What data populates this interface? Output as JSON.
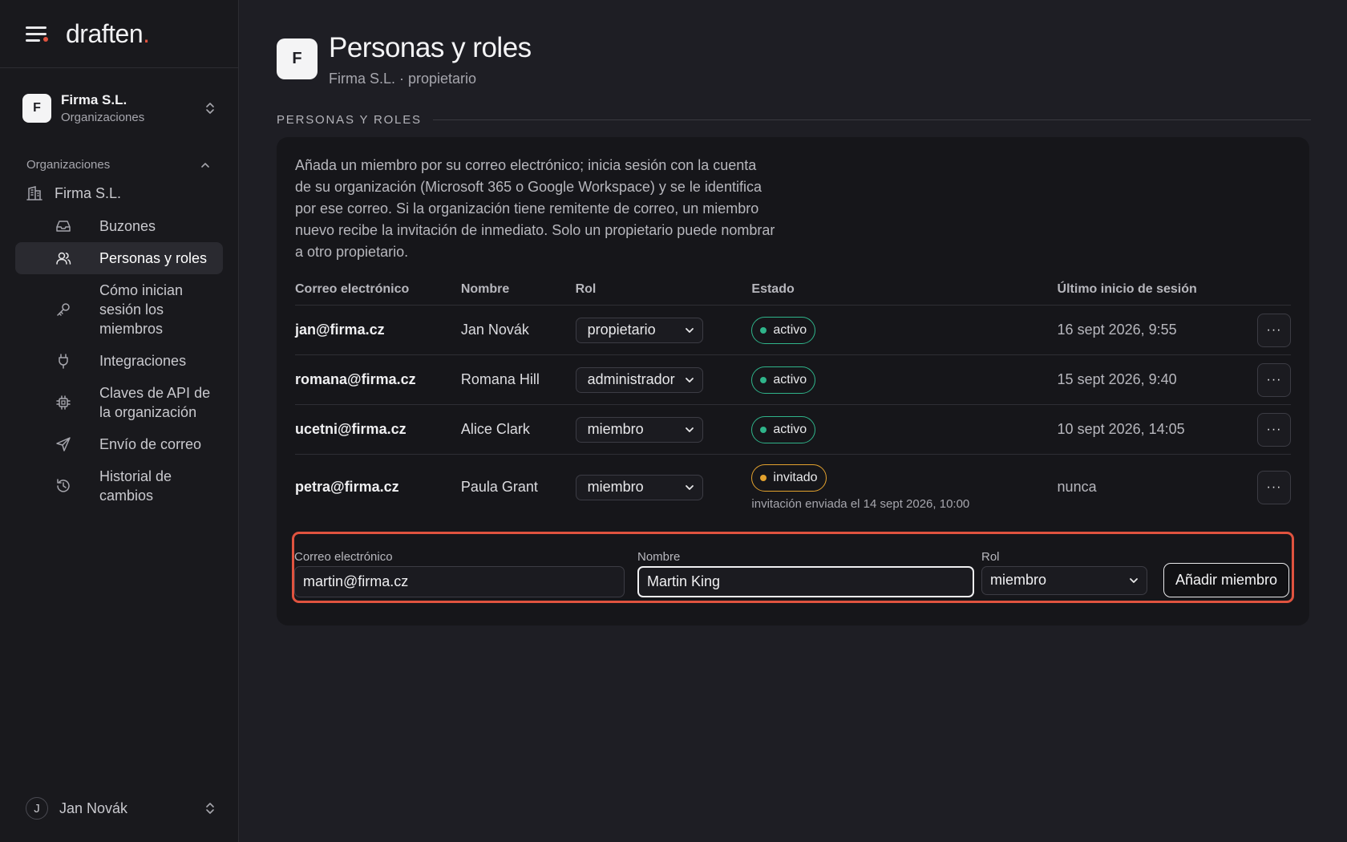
{
  "app": {
    "logo_text": "draften",
    "logo_dot": ".",
    "accent": "#e0533f"
  },
  "sidebar": {
    "org": {
      "initial": "F",
      "name": "Firma S.L.",
      "subtitle": "Organizaciones"
    },
    "section_title": "Organizaciones",
    "org_link": "Firma S.L.",
    "items": [
      {
        "label": "Buzones",
        "icon": "inbox-icon"
      },
      {
        "label": "Personas y roles",
        "icon": "users-icon",
        "active": true
      },
      {
        "label": "Cómo inician sesión los miembros",
        "icon": "key-icon"
      },
      {
        "label": "Integraciones",
        "icon": "plug-icon"
      },
      {
        "label": "Claves de API de la organización",
        "icon": "chip-icon"
      },
      {
        "label": "Envío de correo",
        "icon": "send-icon"
      },
      {
        "label": "Historial de cambios",
        "icon": "history-icon"
      }
    ],
    "user": {
      "initial": "J",
      "name": "Jan Novák"
    }
  },
  "page": {
    "avatar": "F",
    "title": "Personas y roles",
    "subtitle": "Firma S.L. · propietario",
    "section_label": "PERSONAS Y ROLES",
    "intro": "Añada un miembro por su correo electrónico; inicia sesión con la cuenta de su organización (Microsoft 365 o Google Workspace) y se le identifica por ese correo. Si la organización tiene remitente de correo, un miembro nuevo recibe la invitación de inmediato. Solo un propietario puede nombrar a otro propietario."
  },
  "table": {
    "headers": {
      "email": "Correo electrónico",
      "name": "Nombre",
      "role": "Rol",
      "state": "Estado",
      "last": "Último inicio de sesión"
    },
    "rows": [
      {
        "email": "jan@firma.cz",
        "name": "Jan Novák",
        "role": "propietario",
        "state": "activo",
        "last": "16 sept 2026, 9:55"
      },
      {
        "email": "romana@firma.cz",
        "name": "Romana Hill",
        "role": "administrador",
        "state": "activo",
        "last": "15 sept 2026, 9:40"
      },
      {
        "email": "ucetni@firma.cz",
        "name": "Alice Clark",
        "role": "miembro",
        "state": "activo",
        "last": "10 sept 2026, 14:05"
      },
      {
        "email": "petra@firma.cz",
        "name": "Paula Grant",
        "role": "miembro",
        "state": "invitado",
        "note": "invitación enviada el 14 sept 2026, 10:00",
        "last": "nunca"
      }
    ],
    "more_label": "···"
  },
  "form": {
    "email_label": "Correo electrónico",
    "email_value": "martin@firma.cz",
    "name_label": "Nombre",
    "name_value": "Martin King",
    "role_label": "Rol",
    "role_value": "miembro",
    "submit": "Añadir miembro"
  },
  "colors": {
    "active": "#2fb48a",
    "invited": "#e3a22e",
    "highlight": "#e0533f"
  }
}
